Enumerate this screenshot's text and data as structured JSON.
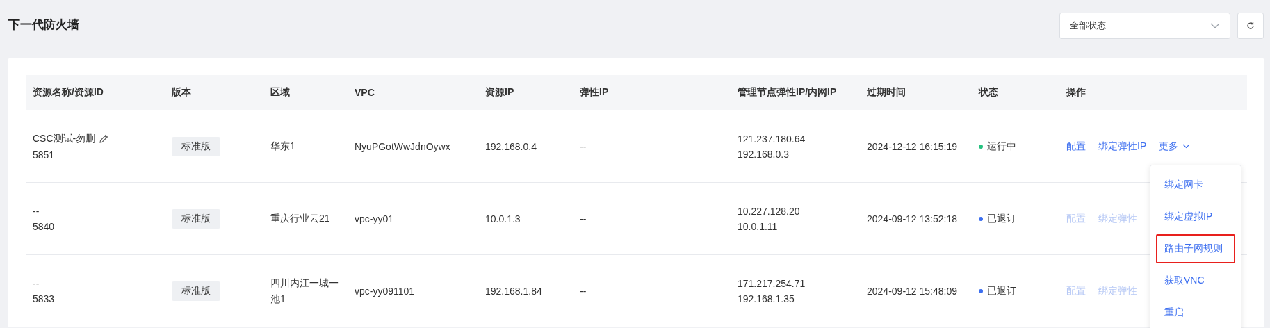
{
  "page_title": "下一代防火墙",
  "status_filter": {
    "value": "全部状态"
  },
  "table": {
    "columns": [
      "资源名称/资源ID",
      "版本",
      "区域",
      "VPC",
      "资源IP",
      "弹性IP",
      "管理节点弹性IP/内网IP",
      "过期时间",
      "状态",
      "操作"
    ],
    "rows": [
      {
        "name": "CSC测试-勿删",
        "editable": true,
        "id": "5851",
        "edition": "标准版",
        "region": "华东1",
        "vpc": "NyuPGotWwJdnOywx",
        "resource_ip": "192.168.0.4",
        "elastic_ip": "--",
        "mgmt_ips": [
          "121.237.180.64",
          "192.168.0.3"
        ],
        "expires": "2024-12-12 16:15:19",
        "status": {
          "label": "运行中",
          "color": "#25c27f"
        },
        "actions": [
          {
            "kind": "link",
            "label": "配置",
            "disabled": false
          },
          {
            "kind": "link",
            "label": "绑定弹性IP",
            "disabled": false
          },
          {
            "kind": "more",
            "label": "更多",
            "disabled": false
          }
        ]
      },
      {
        "name": "--",
        "editable": false,
        "id": "5840",
        "edition": "标准版",
        "region": "重庆行业云21",
        "vpc": "vpc-yy01",
        "resource_ip": "10.0.1.3",
        "elastic_ip": "--",
        "mgmt_ips": [
          "10.227.128.20",
          "10.0.1.11"
        ],
        "expires": "2024-09-12 13:52:18",
        "status": {
          "label": "已退订",
          "color": "#3d6ff0"
        },
        "actions": [
          {
            "kind": "link",
            "label": "配置",
            "disabled": true
          },
          {
            "kind": "link",
            "label": "绑定弹性",
            "disabled": true
          }
        ]
      },
      {
        "name": "--",
        "editable": false,
        "id": "5833",
        "edition": "标准版",
        "region": "四川内江一城一池1",
        "vpc": "vpc-yy091101",
        "resource_ip": "192.168.1.84",
        "elastic_ip": "--",
        "mgmt_ips": [
          "171.217.254.71",
          "192.168.1.35"
        ],
        "expires": "2024-09-12 15:48:09",
        "status": {
          "label": "已退订",
          "color": "#3d6ff0"
        },
        "actions": [
          {
            "kind": "link",
            "label": "配置",
            "disabled": true
          },
          {
            "kind": "link",
            "label": "绑定弹性",
            "disabled": true
          }
        ]
      }
    ]
  },
  "more_menu": {
    "items": [
      {
        "label": "绑定网卡",
        "highlighted": false
      },
      {
        "label": "绑定虚拟IP",
        "highlighted": false
      },
      {
        "label": "路由子网规则",
        "highlighted": true
      },
      {
        "label": "获取VNC",
        "highlighted": false
      },
      {
        "label": "重启",
        "highlighted": false
      }
    ]
  }
}
